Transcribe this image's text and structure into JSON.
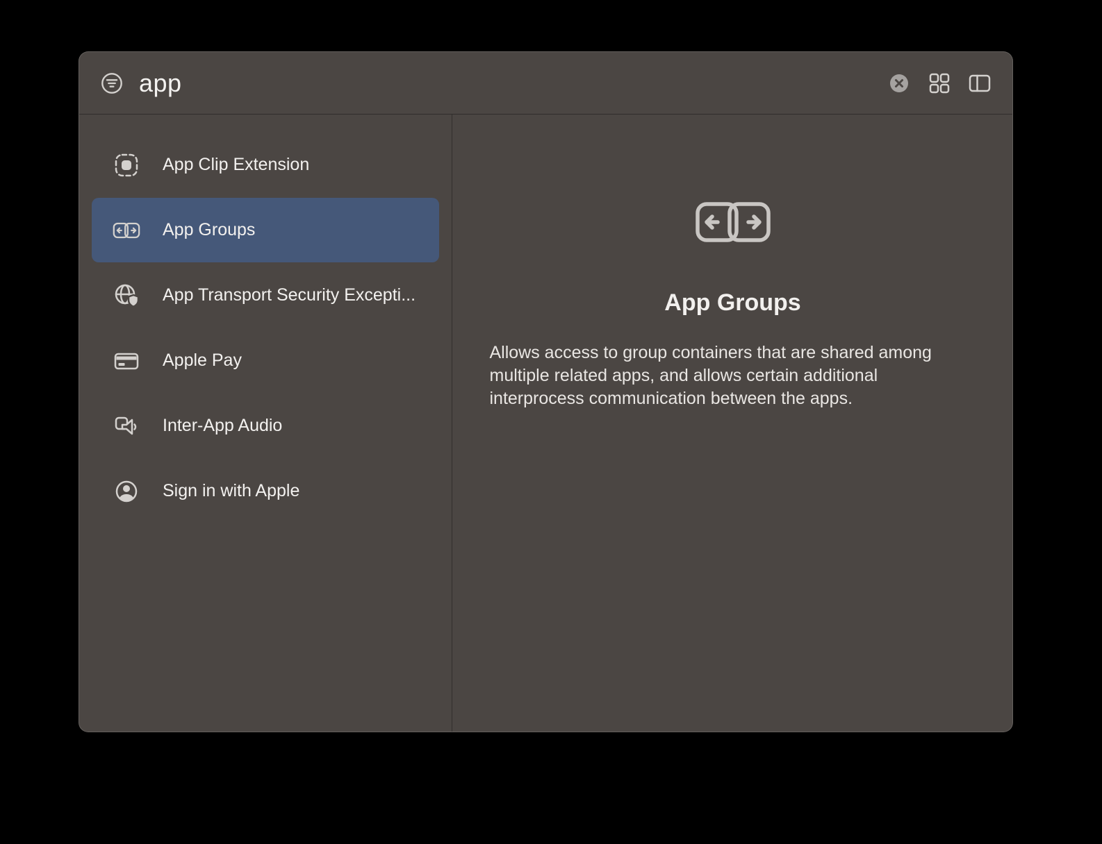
{
  "search": {
    "query": "app",
    "placeholder": ""
  },
  "header": {
    "icons": [
      "filter-circle-icon",
      "clear-circle-icon",
      "grid-view-icon",
      "sidebar-layout-icon"
    ]
  },
  "sidebar": {
    "items": [
      {
        "label": "App Clip Extension",
        "icon": "app-clip-icon",
        "selected": false
      },
      {
        "label": "App Groups",
        "icon": "app-groups-icon",
        "selected": true
      },
      {
        "label": "App Transport Security Excepti...",
        "icon": "globe-shield-icon",
        "selected": false
      },
      {
        "label": "Apple Pay",
        "icon": "credit-card-icon",
        "selected": false
      },
      {
        "label": "Inter-App Audio",
        "icon": "speaker-icon",
        "selected": false
      },
      {
        "label": "Sign in with Apple",
        "icon": "person-circle-icon",
        "selected": false
      }
    ]
  },
  "detail": {
    "title": "App Groups",
    "description": "Allows access to group containers that are shared among multiple related apps, and allows certain additional interprocess communication between the apps."
  },
  "colors": {
    "window_bg": "#4b4643",
    "selection_bg": "#455879",
    "text_primary": "#f3f1ef",
    "text_secondary": "#e9e6e3",
    "icon_gray": "#d4d1ce",
    "outer_bg": "#000000"
  }
}
